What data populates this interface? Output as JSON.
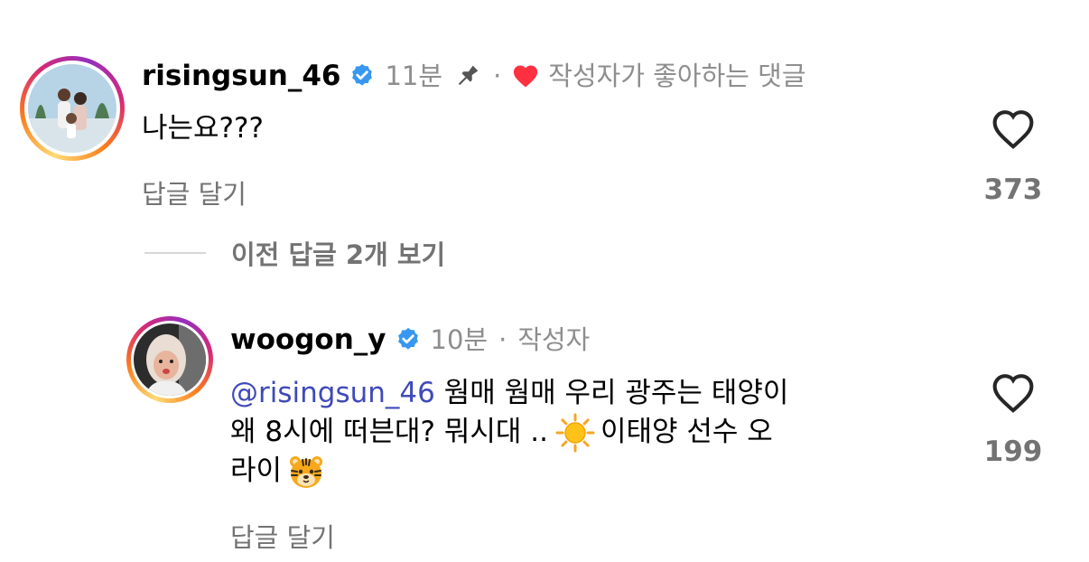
{
  "comment": {
    "username": "risingsun_46",
    "time": "11분",
    "separator": "·",
    "liked_by_author": "작성자가 좋아하는 댓글",
    "text": "나는요???",
    "reply_label": "답글 달기",
    "like_count": "373"
  },
  "view_replies": "이전 답글 2개 보기",
  "reply": {
    "username": "woogon_y",
    "time": "10분",
    "separator": "·",
    "author_label": "작성자",
    "mention": "@risingsun_46",
    "text_line1": " 웜매 웜매 우리 광주는 태양이",
    "text_line2a": "왜 8시에 떠븐대? 뭐시대 ..",
    "text_line2b": " 이태양 선수 오",
    "text_line3": "라이",
    "reply_label": "답글 달기",
    "like_count": "199"
  },
  "colors": {
    "verified": "#3897f0",
    "heart_liked": "#ff3040",
    "mention": "#3f4ab8",
    "secondary_text": "#8e8e8e"
  },
  "icons": [
    "verified-badge-icon",
    "pin-icon",
    "heart-filled-icon",
    "heart-outline-icon",
    "sun-emoji",
    "tiger-emoji"
  ]
}
